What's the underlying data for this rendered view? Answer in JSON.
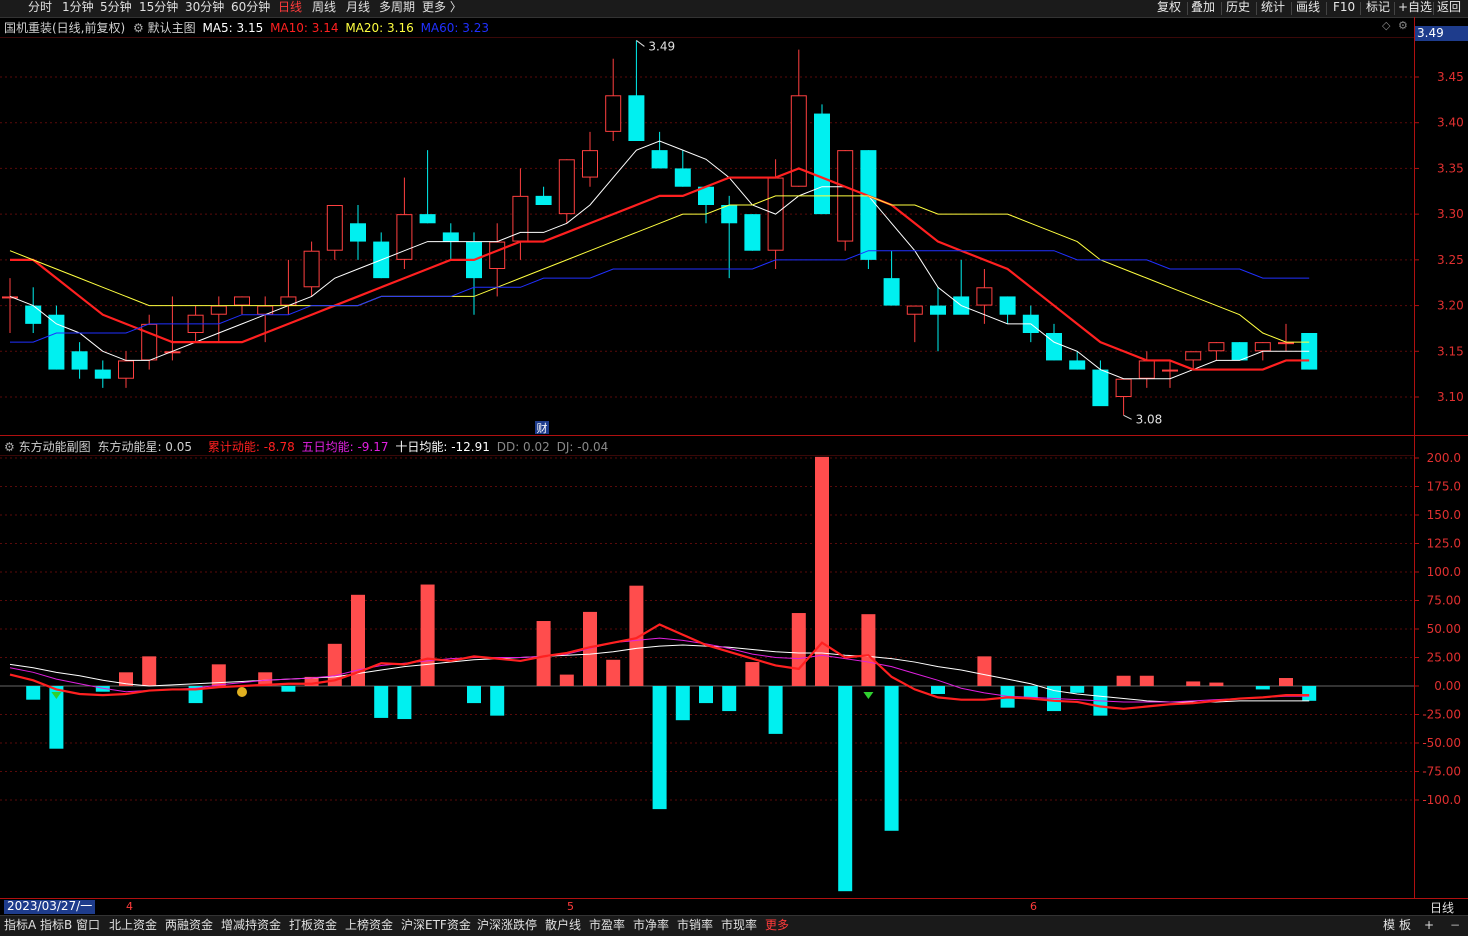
{
  "toolbar": {
    "tabs": [
      "分时",
      "1分钟",
      "5分钟",
      "15分钟",
      "30分钟",
      "60分钟",
      "日线",
      "周线",
      "月线",
      "多周期",
      "更多 〉"
    ],
    "active_tab": "日线",
    "right_buttons": [
      "复权",
      "叠加",
      "历史",
      "统计",
      "画线",
      "F10",
      "标记",
      "+自选",
      "返回"
    ]
  },
  "main_chart": {
    "info": {
      "title": "国机重装(日线,前复权)",
      "indicator_name": "默认主图",
      "ma": [
        {
          "label": "MA5: 3.15",
          "color": "#ffffff"
        },
        {
          "label": "MA10: 3.14",
          "color": "#ff2020"
        },
        {
          "label": "MA20: 3.16",
          "color": "#ffff40"
        },
        {
          "label": "MA60: 3.23",
          "color": "#2030ff"
        }
      ]
    },
    "last_price_tag": "3.49",
    "y_ticks": [
      "3.45",
      "3.40",
      "3.35",
      "3.30",
      "3.25",
      "3.20",
      "3.15",
      "3.10"
    ],
    "annotations": {
      "high": "3.49",
      "low": "3.08",
      "news_badge": "财"
    }
  },
  "sub_chart": {
    "info": {
      "name": "东方动能副图",
      "star": "东方动能星: 0.05",
      "cum": "累计动能: -8.78",
      "five": "五日均能: -9.17",
      "ten": "十日均能: -12.91",
      "dd": "DD: 0.02",
      "dj": "DJ: -0.04"
    },
    "y_ticks": [
      "200.0",
      "175.0",
      "150.0",
      "125.0",
      "100.0",
      "75.00",
      "50.00",
      "25.00",
      "0.00",
      "-25.00",
      "-50.00",
      "-75.00",
      "-100.0"
    ]
  },
  "chart_data": [
    {
      "type": "candlestick",
      "title": "国机重装(日线,前复权)",
      "ylim": [
        3.075,
        3.5
      ],
      "x": [
        "d1",
        "d2",
        "d3",
        "d4",
        "d5",
        "d6",
        "d7",
        "d8",
        "d9",
        "d10",
        "d11",
        "d12",
        "d13",
        "d14",
        "d15",
        "d16",
        "d17",
        "d18",
        "d19",
        "d20",
        "d21",
        "d22",
        "d23",
        "d24",
        "d25",
        "d26",
        "d27",
        "d28",
        "d29",
        "d30",
        "d31",
        "d32",
        "d33",
        "d34",
        "d35",
        "d36",
        "d37",
        "d38",
        "d39",
        "d40",
        "d41",
        "d42",
        "d43",
        "d44",
        "d45",
        "d46",
        "d47",
        "d48",
        "d49",
        "d50",
        "d51",
        "d52",
        "d53",
        "d54",
        "d55",
        "d56",
        "d57"
      ],
      "ohlc": [
        [
          3.21,
          3.23,
          3.17,
          3.21
        ],
        [
          3.2,
          3.22,
          3.17,
          3.18
        ],
        [
          3.19,
          3.2,
          3.13,
          3.13
        ],
        [
          3.15,
          3.16,
          3.12,
          3.13
        ],
        [
          3.13,
          3.14,
          3.11,
          3.12
        ],
        [
          3.12,
          3.15,
          3.11,
          3.14
        ],
        [
          3.14,
          3.19,
          3.13,
          3.18
        ],
        [
          3.15,
          3.21,
          3.14,
          3.15
        ],
        [
          3.17,
          3.2,
          3.16,
          3.19
        ],
        [
          3.19,
          3.21,
          3.16,
          3.2
        ],
        [
          3.2,
          3.21,
          3.19,
          3.21
        ],
        [
          3.19,
          3.21,
          3.16,
          3.2
        ],
        [
          3.2,
          3.25,
          3.19,
          3.21
        ],
        [
          3.22,
          3.27,
          3.21,
          3.26
        ],
        [
          3.26,
          3.31,
          3.25,
          3.31
        ],
        [
          3.29,
          3.31,
          3.25,
          3.27
        ],
        [
          3.27,
          3.28,
          3.23,
          3.23
        ],
        [
          3.25,
          3.34,
          3.24,
          3.3
        ],
        [
          3.3,
          3.37,
          3.29,
          3.29
        ],
        [
          3.28,
          3.29,
          3.25,
          3.27
        ],
        [
          3.27,
          3.28,
          3.19,
          3.23
        ],
        [
          3.24,
          3.29,
          3.21,
          3.27
        ],
        [
          3.27,
          3.35,
          3.25,
          3.32
        ],
        [
          3.32,
          3.33,
          3.31,
          3.31
        ],
        [
          3.3,
          3.36,
          3.29,
          3.36
        ],
        [
          3.34,
          3.39,
          3.33,
          3.37
        ],
        [
          3.39,
          3.47,
          3.38,
          3.43
        ],
        [
          3.43,
          3.49,
          3.38,
          3.38
        ],
        [
          3.37,
          3.39,
          3.35,
          3.35
        ],
        [
          3.35,
          3.37,
          3.33,
          3.33
        ],
        [
          3.33,
          3.33,
          3.29,
          3.31
        ],
        [
          3.31,
          3.32,
          3.23,
          3.29
        ],
        [
          3.3,
          3.3,
          3.26,
          3.26
        ],
        [
          3.26,
          3.36,
          3.24,
          3.34
        ],
        [
          3.33,
          3.48,
          3.33,
          3.43
        ],
        [
          3.41,
          3.42,
          3.3,
          3.3
        ],
        [
          3.27,
          3.37,
          3.26,
          3.37
        ],
        [
          3.37,
          3.37,
          3.24,
          3.25
        ],
        [
          3.23,
          3.26,
          3.2,
          3.2
        ],
        [
          3.19,
          3.2,
          3.16,
          3.2
        ],
        [
          3.2,
          3.22,
          3.15,
          3.19
        ],
        [
          3.21,
          3.25,
          3.2,
          3.19
        ],
        [
          3.2,
          3.24,
          3.18,
          3.22
        ],
        [
          3.21,
          3.21,
          3.18,
          3.19
        ],
        [
          3.19,
          3.2,
          3.16,
          3.17
        ],
        [
          3.17,
          3.18,
          3.14,
          3.14
        ],
        [
          3.14,
          3.15,
          3.13,
          3.13
        ],
        [
          3.13,
          3.14,
          3.1,
          3.09
        ],
        [
          3.1,
          3.12,
          3.08,
          3.12
        ],
        [
          3.12,
          3.15,
          3.11,
          3.14
        ],
        [
          3.13,
          3.14,
          3.11,
          3.13
        ],
        [
          3.14,
          3.15,
          3.13,
          3.15
        ],
        [
          3.15,
          3.16,
          3.14,
          3.16
        ],
        [
          3.16,
          3.16,
          3.14,
          3.14
        ],
        [
          3.15,
          3.16,
          3.14,
          3.16
        ],
        [
          3.16,
          3.18,
          3.15,
          3.16
        ],
        [
          3.17,
          3.17,
          3.13,
          3.13
        ]
      ],
      "series": [
        {
          "name": "MA5",
          "color": "#ffffff",
          "values": [
            3.21,
            3.2,
            3.18,
            3.17,
            3.15,
            3.14,
            3.14,
            3.15,
            3.16,
            3.17,
            3.18,
            3.19,
            3.2,
            3.21,
            3.23,
            3.24,
            3.25,
            3.26,
            3.27,
            3.27,
            3.27,
            3.27,
            3.28,
            3.28,
            3.29,
            3.31,
            3.34,
            3.37,
            3.38,
            3.37,
            3.36,
            3.34,
            3.31,
            3.3,
            3.32,
            3.33,
            3.33,
            3.32,
            3.29,
            3.26,
            3.22,
            3.2,
            3.19,
            3.18,
            3.18,
            3.16,
            3.15,
            3.13,
            3.12,
            3.12,
            3.12,
            3.13,
            3.14,
            3.14,
            3.15,
            3.15,
            3.15
          ]
        },
        {
          "name": "MA10",
          "color": "#ff2020",
          "values": [
            3.25,
            3.25,
            3.23,
            3.21,
            3.19,
            3.18,
            3.17,
            3.16,
            3.16,
            3.16,
            3.16,
            3.17,
            3.18,
            3.19,
            3.2,
            3.21,
            3.22,
            3.23,
            3.24,
            3.25,
            3.25,
            3.26,
            3.27,
            3.27,
            3.28,
            3.29,
            3.3,
            3.31,
            3.32,
            3.32,
            3.33,
            3.34,
            3.34,
            3.34,
            3.35,
            3.34,
            3.33,
            3.32,
            3.31,
            3.29,
            3.27,
            3.26,
            3.25,
            3.24,
            3.22,
            3.2,
            3.18,
            3.16,
            3.15,
            3.14,
            3.14,
            3.13,
            3.13,
            3.13,
            3.13,
            3.14,
            3.14
          ]
        },
        {
          "name": "MA20",
          "color": "#ffff40",
          "values": [
            3.26,
            3.25,
            3.24,
            3.23,
            3.22,
            3.21,
            3.2,
            3.2,
            3.2,
            3.2,
            3.2,
            3.2,
            3.2,
            3.2,
            3.2,
            3.2,
            3.21,
            3.21,
            3.21,
            3.21,
            3.21,
            3.22,
            3.23,
            3.24,
            3.25,
            3.26,
            3.27,
            3.28,
            3.29,
            3.3,
            3.3,
            3.31,
            3.31,
            3.32,
            3.32,
            3.32,
            3.32,
            3.32,
            3.31,
            3.31,
            3.3,
            3.3,
            3.3,
            3.3,
            3.29,
            3.28,
            3.27,
            3.25,
            3.24,
            3.23,
            3.22,
            3.21,
            3.2,
            3.19,
            3.17,
            3.16,
            3.16
          ]
        },
        {
          "name": "MA60",
          "color": "#2030ff",
          "values": [
            3.16,
            3.16,
            3.17,
            3.17,
            3.17,
            3.17,
            3.18,
            3.18,
            3.18,
            3.18,
            3.19,
            3.19,
            3.19,
            3.2,
            3.2,
            3.2,
            3.21,
            3.21,
            3.21,
            3.21,
            3.22,
            3.22,
            3.22,
            3.23,
            3.23,
            3.23,
            3.24,
            3.24,
            3.24,
            3.24,
            3.24,
            3.24,
            3.24,
            3.25,
            3.25,
            3.25,
            3.25,
            3.26,
            3.26,
            3.26,
            3.26,
            3.26,
            3.26,
            3.26,
            3.26,
            3.26,
            3.25,
            3.25,
            3.25,
            3.25,
            3.24,
            3.24,
            3.24,
            3.24,
            3.23,
            3.23,
            3.23
          ]
        }
      ]
    },
    {
      "type": "bar",
      "title": "东方动能副图",
      "ylim": [
        -110,
        210
      ],
      "x": [
        "d1",
        "d2",
        "d3",
        "d4",
        "d5",
        "d6",
        "d7",
        "d8",
        "d9",
        "d10",
        "d11",
        "d12",
        "d13",
        "d14",
        "d15",
        "d16",
        "d17",
        "d18",
        "d19",
        "d20",
        "d21",
        "d22",
        "d23",
        "d24",
        "d25",
        "d26",
        "d27",
        "d28",
        "d29",
        "d30",
        "d31",
        "d32",
        "d33",
        "d34",
        "d35",
        "d36",
        "d37",
        "d38",
        "d39",
        "d40",
        "d41",
        "d42",
        "d43",
        "d44",
        "d45",
        "d46",
        "d47",
        "d48",
        "d49",
        "d50",
        "d51",
        "d52",
        "d53",
        "d54",
        "d55",
        "d56",
        "d57"
      ],
      "values": [
        0,
        -12,
        -55,
        0,
        -5,
        12,
        26,
        0,
        -15,
        19,
        0,
        12,
        -5,
        8,
        37,
        80,
        -28,
        -29,
        89,
        0,
        -15,
        -26,
        0,
        57,
        10,
        65,
        23,
        88,
        -108,
        -30,
        -15,
        -22,
        21,
        -42,
        64,
        201,
        -180,
        63,
        -127,
        0,
        -7,
        0,
        26,
        -19,
        -11,
        -22,
        -6,
        -26,
        9,
        9,
        0,
        4,
        3,
        0,
        -3,
        7,
        -13
      ],
      "series": [
        {
          "name": "累计动能",
          "color": "#ff2020",
          "values": [
            10,
            5,
            -3,
            -7,
            -8,
            -7,
            -4,
            -3,
            -3,
            -1,
            0,
            1,
            2,
            2,
            5,
            12,
            20,
            19,
            24,
            22,
            26,
            24,
            22,
            26,
            29,
            34,
            38,
            42,
            54,
            45,
            36,
            30,
            24,
            18,
            15,
            38,
            25,
            27,
            8,
            -3,
            -10,
            -12,
            -12,
            -10,
            -11,
            -13,
            -14,
            -18,
            -20,
            -18,
            -16,
            -15,
            -13,
            -11,
            -10,
            -8,
            -8
          ]
        },
        {
          "name": "五日均能",
          "color": "#e020e0",
          "values": [
            16,
            12,
            6,
            2,
            -2,
            -5,
            -4,
            -3,
            -2,
            1,
            3,
            5,
            6,
            7,
            9,
            14,
            18,
            20,
            22,
            24,
            25,
            25,
            25,
            26,
            28,
            33,
            38,
            40,
            42,
            40,
            37,
            33,
            28,
            25,
            24,
            27,
            24,
            21,
            17,
            11,
            5,
            -2,
            -6,
            -9,
            -10,
            -11,
            -12,
            -13,
            -14,
            -14,
            -14,
            -13,
            -12,
            -11,
            -10,
            -9,
            -9
          ]
        },
        {
          "name": "十日均能",
          "color": "#ffffff",
          "values": [
            19,
            16,
            12,
            9,
            5,
            2,
            0,
            1,
            2,
            3,
            4,
            5,
            6,
            7,
            8,
            11,
            14,
            17,
            19,
            21,
            23,
            24,
            25,
            26,
            27,
            28,
            30,
            33,
            35,
            36,
            35,
            34,
            32,
            30,
            29,
            29,
            27,
            26,
            24,
            21,
            17,
            14,
            10,
            6,
            2,
            -4,
            -7,
            -9,
            -11,
            -13,
            -14,
            -14,
            -14,
            -13,
            -13,
            -13,
            -13
          ]
        }
      ]
    }
  ],
  "date_bar": {
    "start_date": "2023/03/27/一",
    "month_ticks": [
      "4",
      "5",
      "6"
    ],
    "period": "日线"
  },
  "bottom_tabs": [
    "指标A",
    "指标B",
    "窗口",
    "北上资金",
    "两融资金",
    "增减持资金",
    "打板资金",
    "上榜资金",
    "沪深ETF资金",
    "沪深涨跌停",
    "散户线",
    "市盈率",
    "市净率",
    "市销率",
    "市现率",
    "更多"
  ],
  "bottom_right": [
    "模",
    "板",
    "+"
  ]
}
